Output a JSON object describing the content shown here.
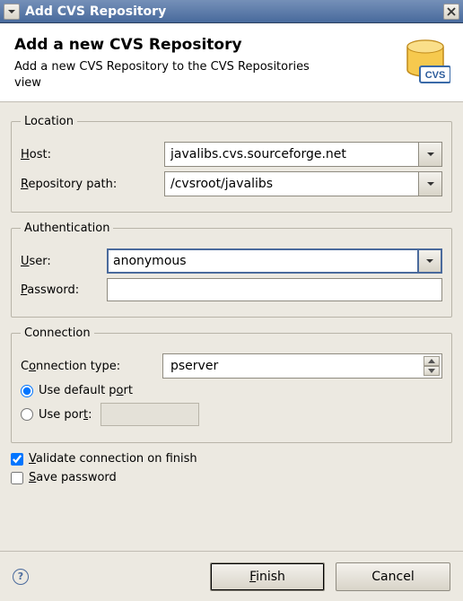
{
  "window": {
    "title": "Add CVS Repository"
  },
  "header": {
    "title": "Add a new CVS Repository",
    "subtitle": "Add a new CVS Repository to the CVS Repositories view",
    "icon_label": "CVS"
  },
  "location": {
    "legend": "Location",
    "host_label": "Host:",
    "host_value": "javalibs.cvs.sourceforge.net",
    "repo_label": "Repository path:",
    "repo_value": "/cvsroot/javalibs"
  },
  "auth": {
    "legend": "Authentication",
    "user_label": "User:",
    "user_value": "anonymous",
    "password_label": "Password:",
    "password_value": ""
  },
  "connection": {
    "legend": "Connection",
    "type_label": "Connection type:",
    "type_value": "pserver",
    "default_port_label": "Use default port",
    "use_port_label": "Use port:",
    "port_value": ""
  },
  "options": {
    "validate_label": "Validate connection on finish",
    "save_pwd_label": "Save password"
  },
  "buttons": {
    "finish": "Finish",
    "cancel": "Cancel"
  }
}
